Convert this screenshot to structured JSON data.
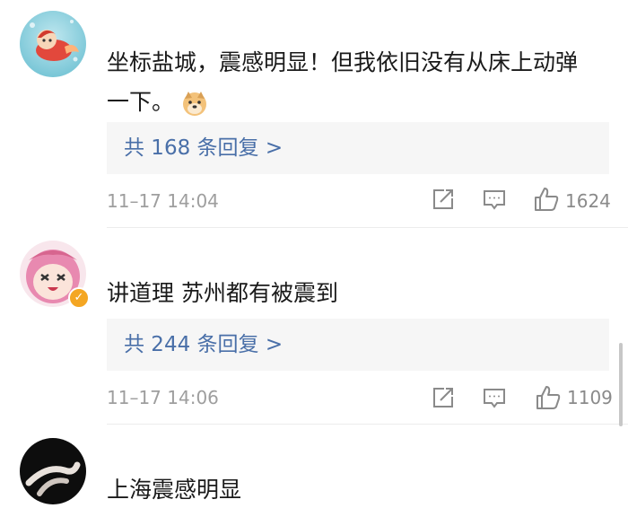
{
  "comments": [
    {
      "text_line1": "坐标盐城，震感明显！但我依旧没有从床上动弹",
      "text_line2": "一下。",
      "emoji": "doge-emoji",
      "replies": "共 168 条回复 >",
      "time": "11–17 14:04",
      "likes": "1624",
      "avatar": "anime-girl-underwater-avatar",
      "verified": false
    },
    {
      "text_line1": "讲道理 苏州都有被震到",
      "replies": "共 244 条回复 >",
      "time": "11–17 14:06",
      "likes": "1109",
      "avatar": "pink-hair-anime-avatar",
      "verified": true
    },
    {
      "text_line1": "上海震感明显",
      "avatar": "dark-hands-photo-avatar",
      "verified": false
    }
  ],
  "colors": {
    "reply_link": "#496fa8",
    "reply_bg": "#f6f6f6",
    "meta": "#9e9e9e",
    "verified_badge": "#f4a623"
  },
  "icons": {
    "share": "share-icon",
    "comment": "comment-icon",
    "like": "thumbs-up-icon"
  }
}
